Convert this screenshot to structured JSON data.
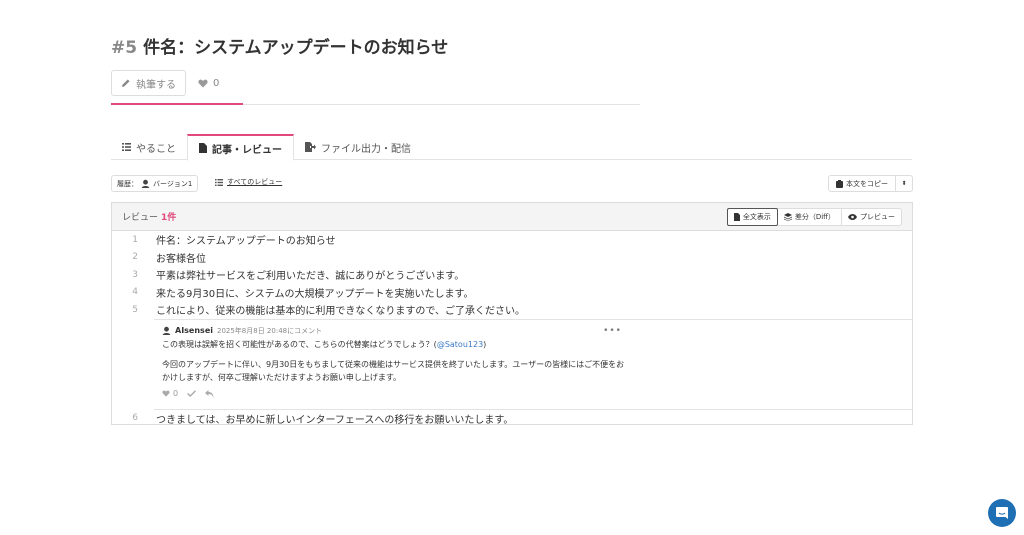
{
  "page": {
    "number": "#5",
    "title": "件名：システムアップデートのお知らせ"
  },
  "actions": {
    "write_label": "執筆する",
    "like_count": "0",
    "progress_fraction": 0.25
  },
  "tabs": [
    {
      "label": "やること",
      "icon": "list-icon"
    },
    {
      "label": "記事・レビュー",
      "icon": "file-icon"
    },
    {
      "label": "ファイル出力・配信",
      "icon": "file-export-icon"
    }
  ],
  "toolbar": {
    "history_label": "履歴：",
    "version_label": "バージョン1",
    "all_reviews_label": "すべてのレビュー",
    "copy_label": "本文をコピー",
    "caret": "⬍"
  },
  "review": {
    "label": "レビュー",
    "count": "1件",
    "views": [
      {
        "label": "全文表示",
        "icon": "file-icon"
      },
      {
        "label": "差分（Diff）",
        "icon": "layers-icon"
      },
      {
        "label": "プレビュー",
        "icon": "eye-icon"
      }
    ]
  },
  "lines": [
    {
      "n": "1",
      "text": "件名：システムアップデートのお知らせ"
    },
    {
      "n": "2",
      "text": "お客様各位"
    },
    {
      "n": "3",
      "text": "平素は弊社サービスをご利用いただき、誠にありがとうございます。"
    },
    {
      "n": "4",
      "text": "来たる9月30日に、システムの大規模アップデートを実施いたします。"
    },
    {
      "n": "5",
      "text": "これにより、従来の機能は基本的に利用できなくなりますので、ご了承ください。"
    },
    {
      "n": "6",
      "text": "つきましては、お早めに新しいインターフェースへの移行をお願いいたします。"
    }
  ],
  "comment": {
    "author": "AIsensei",
    "time": "2025年8月8日 20:48にコメント",
    "more": "•••",
    "body1": "この表現は誤解を招く可能性があるので、こちらの代替案はどうでしょう？(",
    "mention": "@Satou123",
    "body1_end": ")",
    "body2": "今回のアップデートに伴い、9月30日をもちまして従来の機能はサービス提供を終了いたします。ユーザーの皆様にはご不便をおかけしますが、何卒ご理解いただけますようお願い申し上げます。",
    "like_count": "0"
  },
  "colors": {
    "accent": "#e0497a",
    "link": "#3a78c3",
    "chat": "#1f6fb5"
  }
}
